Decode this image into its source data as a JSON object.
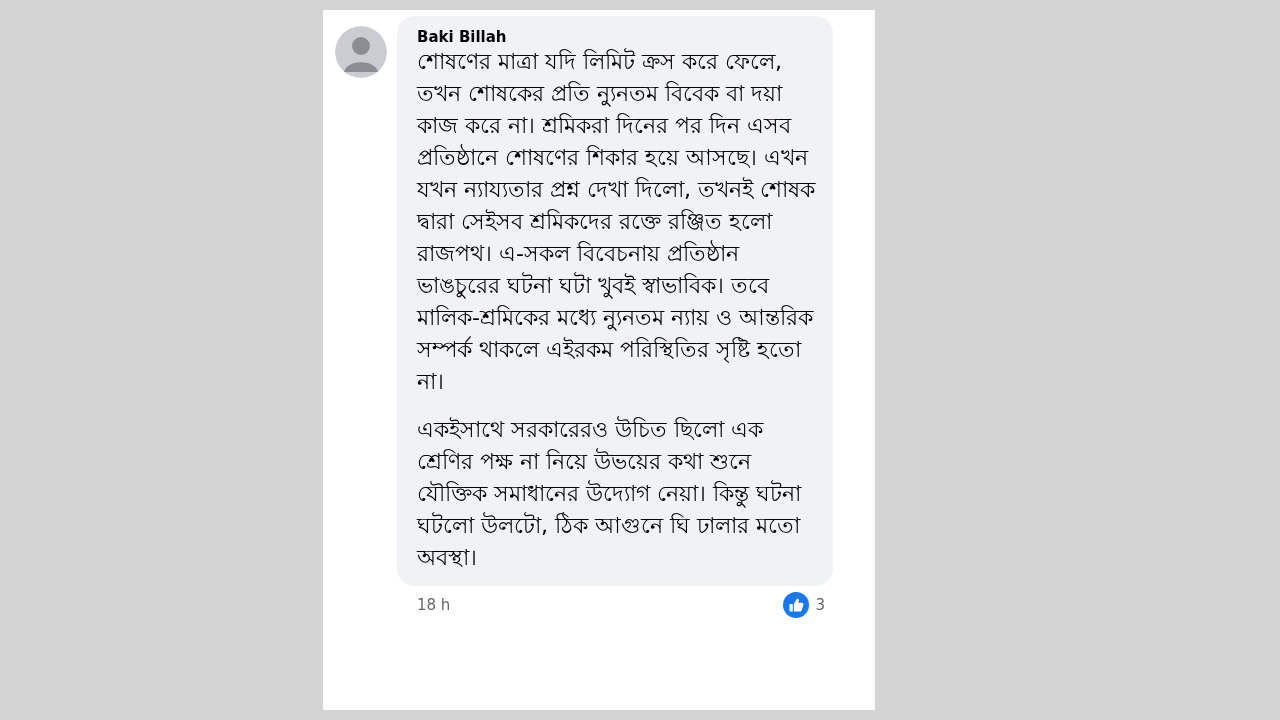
{
  "comment": {
    "author": "Baki Billah",
    "paragraphs": [
      "শোষণের মাত্রা যদি লিমিট ক্রস করে ফেলে, তখন শোষকের প্রতি ন্যুনতম বিবেক বা দয়া কাজ করে না। শ্রমিকরা দিনের পর দিন এসব প্রতিষ্ঠানে শোষণের শিকার হয়ে আসছে। এখন যখন ন্যায্যতার প্রশ্ন দেখা দিলো, তখনই শোষক দ্বারা সেইসব শ্রমিকদের রক্তে রঞ্জিত হলো রাজপথ। এ-সকল বিবেচনায় প্রতিষ্ঠান ভাঙচুরের ঘটনা ঘটা খুবই স্বাভাবিক। তবে মালিক-শ্রমিকের মধ্যে ন্যুনতম ন্যায় ও আন্তরিক সম্পর্ক থাকলে এইরকম পরিস্থিতির সৃষ্টি হতো না।",
      "একইসাথে সরকারেরও উচিত ছিলো এক শ্রেণির পক্ষ না নিয়ে উভয়ের কথা শুনে যৌক্তিক সমাধানের উদ্যোগ নেয়া। কিন্তু ঘটনা ঘটলো উলটো, ঠিক আগুনে ঘি ঢালার মতো অবস্থা।"
    ],
    "time": "18 h",
    "reaction_count": "3"
  }
}
